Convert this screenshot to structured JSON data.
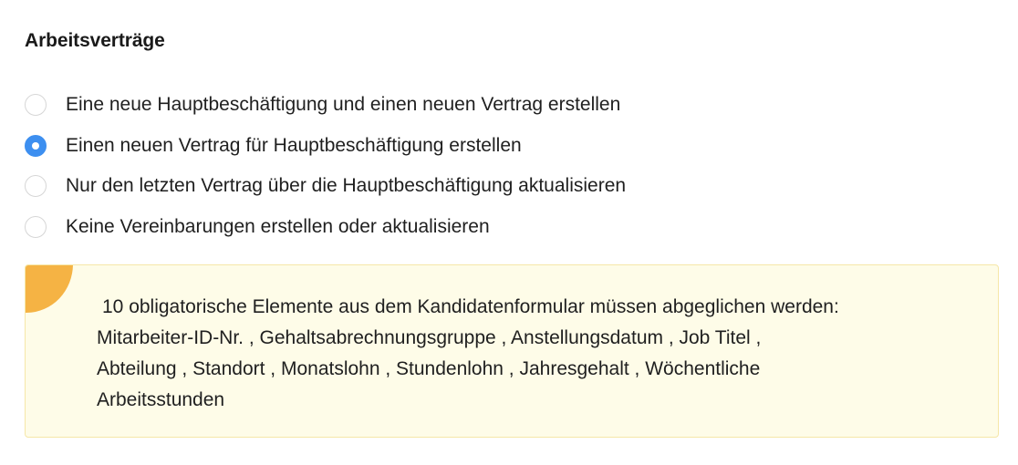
{
  "section": {
    "title": "Arbeitsverträge"
  },
  "contract_options": [
    {
      "label": "Eine neue Hauptbeschäftigung und einen neuen Vertrag erstellen",
      "selected": false
    },
    {
      "label": "Einen neuen Vertrag für Hauptbeschäftigung erstellen",
      "selected": true
    },
    {
      "label": "Nur den letzten Vertrag über die Hauptbeschäftigung aktualisieren",
      "selected": false
    },
    {
      "label": "Keine Vereinbarungen erstellen oder aktualisieren",
      "selected": false
    }
  ],
  "notice": {
    "icon": "warning-icon",
    "intro": "10 obligatorische Elemente aus dem Kandidatenformular müssen abgeglichen werden:",
    "line1": "Mitarbeiter-ID-Nr.  ,  Gehaltsabrechnungsgruppe  ,  Anstellungsdatum  ,  Job Titel  ,",
    "line2": "Abteilung  ,  Standort  ,  Monatslohn  ,  Stundenlohn  ,  Jahresgehalt  ,  Wöchentliche",
    "line3": "Arbeitsstunden"
  },
  "colors": {
    "radio_selected": "#3d8ff0",
    "radio_border": "#d6d6d6",
    "notice_background": "#fefce8",
    "notice_border": "#f6e7a8",
    "warning_badge": "#f5b344"
  }
}
